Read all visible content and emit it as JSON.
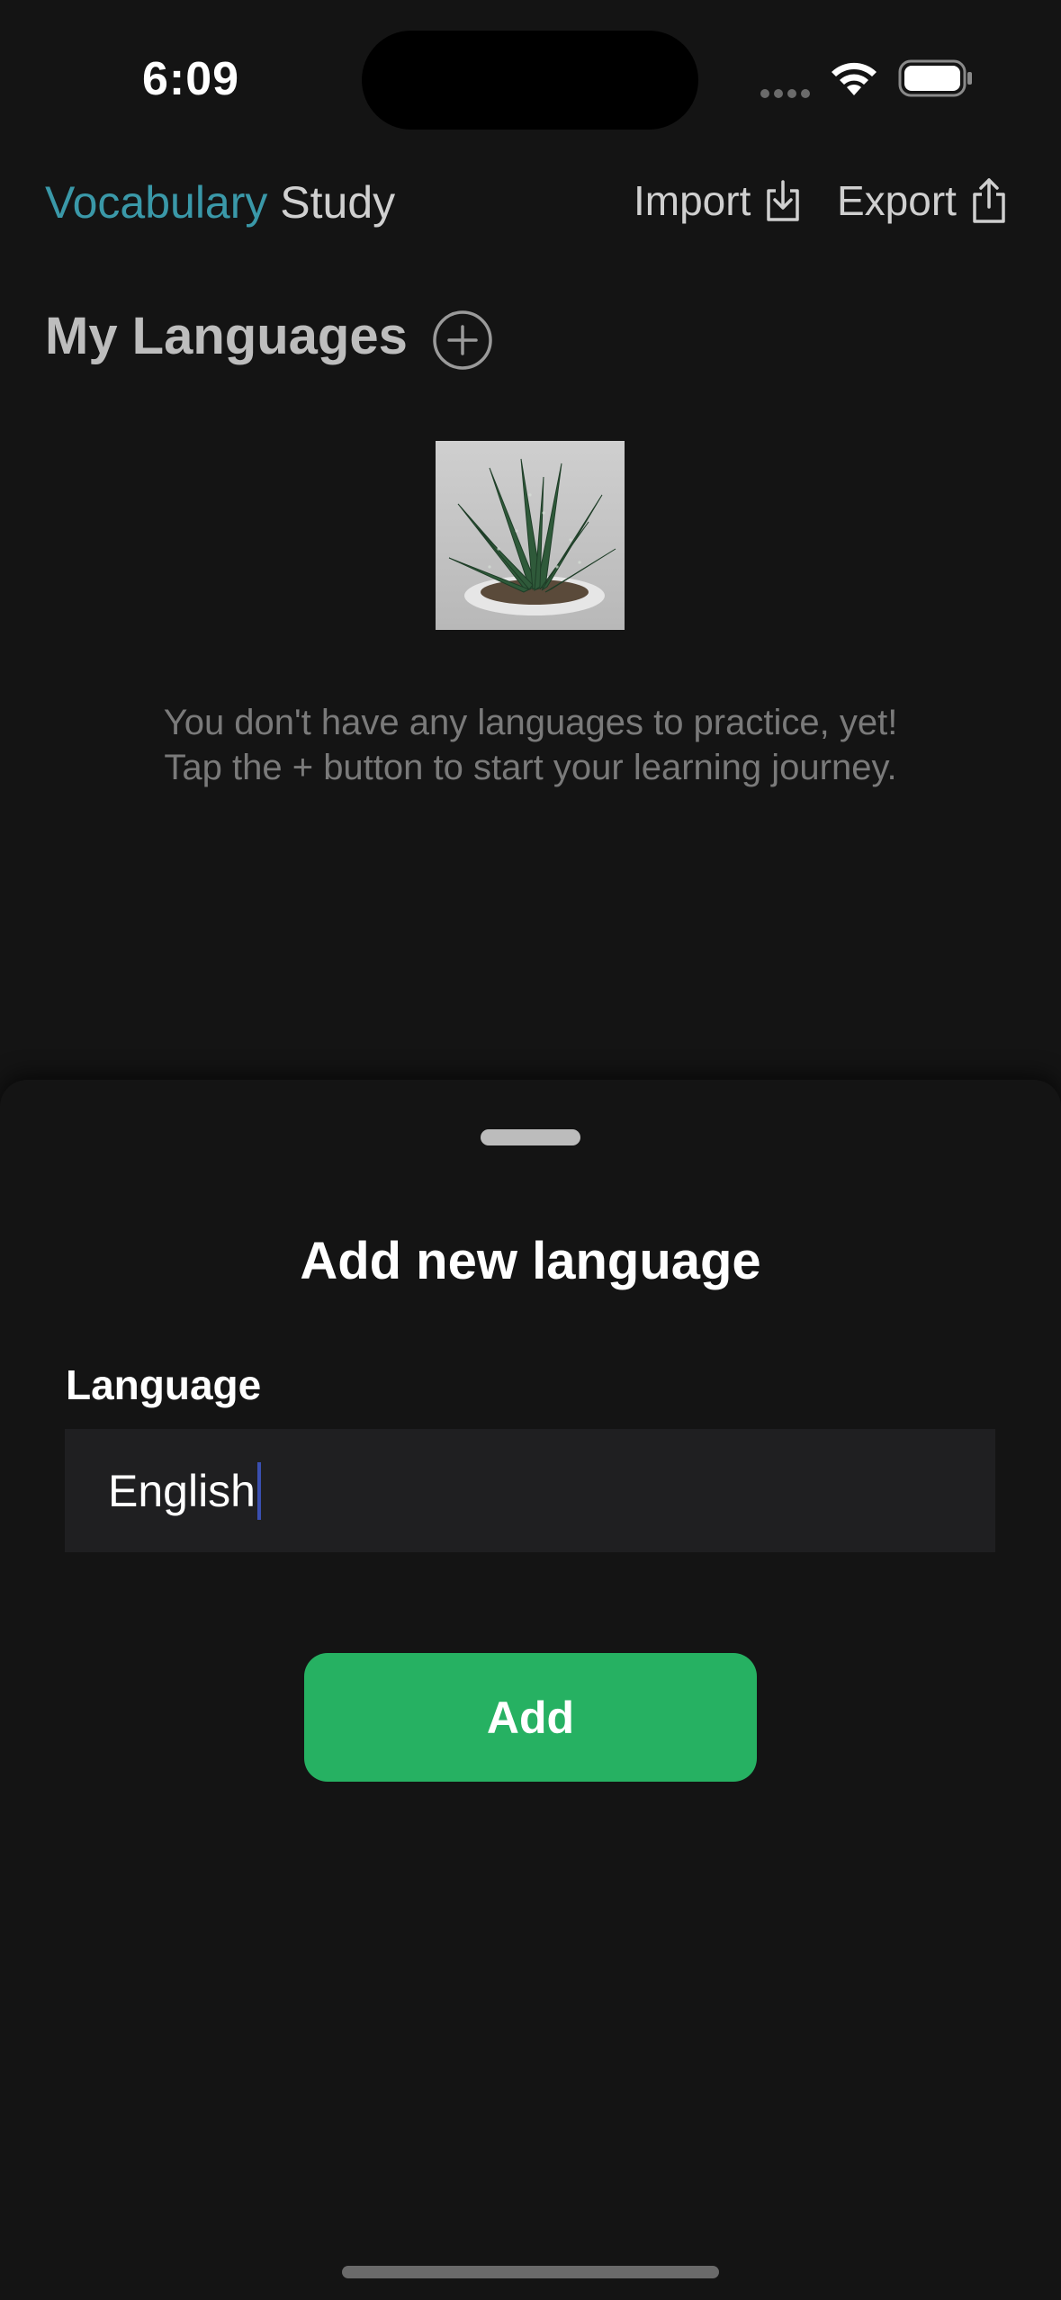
{
  "status_bar": {
    "time": "6:09"
  },
  "header": {
    "title_accent": "Vocabulary",
    "title_rest": "Study",
    "import_label": "Import",
    "export_label": "Export"
  },
  "section": {
    "title": "My Languages"
  },
  "empty_state": {
    "line1": "You don't have any languages to practice, yet!",
    "line2": "Tap the + button to start your learning journey."
  },
  "sheet": {
    "title": "Add new language",
    "field_label": "Language",
    "field_value": "English",
    "add_label": "Add"
  },
  "colors": {
    "accent": "#3a98a8",
    "add_button": "#26b162",
    "background": "#141414"
  },
  "icons": [
    "wifi-icon",
    "battery-icon",
    "import-icon",
    "export-icon",
    "plus-circle-icon"
  ]
}
